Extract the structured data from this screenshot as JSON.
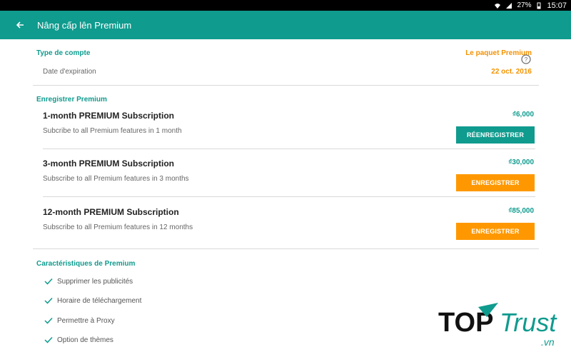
{
  "status_bar": {
    "battery": "27%",
    "time": "15:07"
  },
  "app_bar": {
    "title": "Nâng cấp lên Premium"
  },
  "account": {
    "type_label": "Type de compte",
    "type_value": "Le paquet Premium",
    "expiry_label": "Date d'expiration",
    "expiry_value": "22 oct. 2016"
  },
  "register": {
    "section_title": "Enregistrer Premium",
    "plans": [
      {
        "title": "1-month PREMIUM Subscription",
        "description": "Subcribe to all Premium features in 1 month",
        "price": "₫6,000",
        "button": "RÉENREGISTRER"
      },
      {
        "title": "3-month PREMIUM Subscription",
        "description": "Subscribe to all Premium features in 3 months",
        "price": "₫30,000",
        "button": "ENREGISTRER"
      },
      {
        "title": "12-month PREMIUM Subscription",
        "description": "Subscribe to all Premium features in 12 months",
        "price": "₫85,000",
        "button": "ENREGISTRER"
      }
    ]
  },
  "features": {
    "section_title": "Caractéristiques de Premium",
    "items": [
      "Supprimer les publicités",
      "Horaire de téléchargement",
      "Permettre à Proxy",
      "Option de thèmes"
    ]
  },
  "watermark": {
    "text_top": "TOP",
    "text_main": "Trust",
    "text_sub": ".vn"
  },
  "colors": {
    "primary": "#0f9b8e",
    "accent": "#ff9800",
    "status_bar": "#000000"
  }
}
